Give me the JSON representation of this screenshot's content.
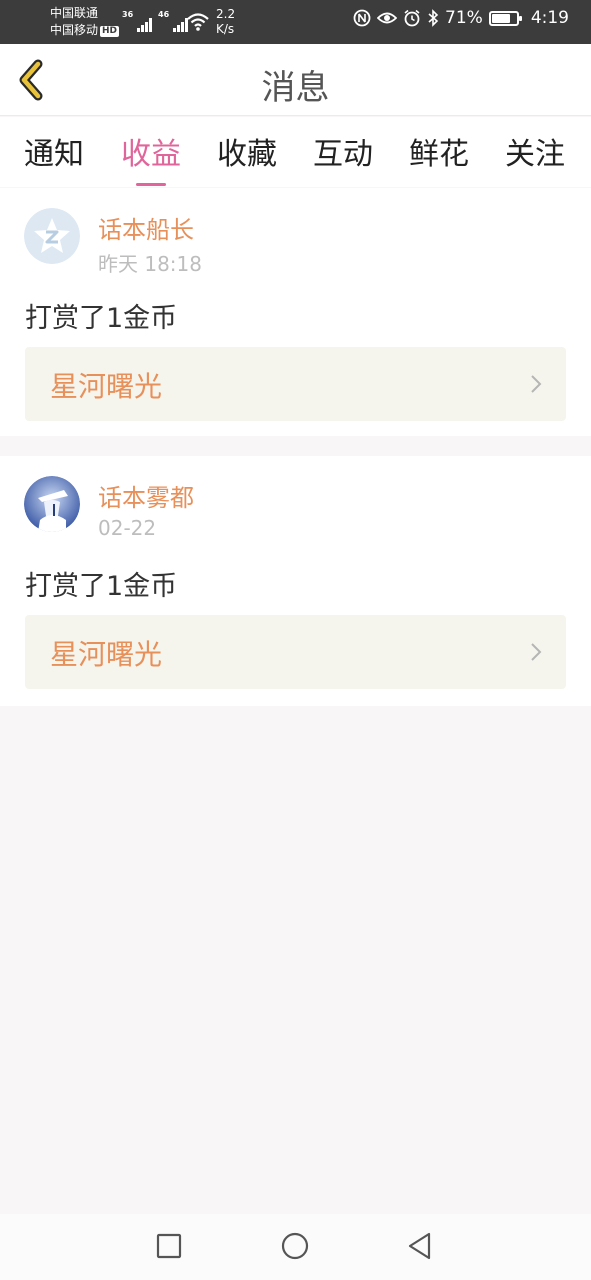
{
  "status_bar": {
    "carrier1": "中国联通",
    "carrier2": "中国移动",
    "hd_badge": "HD",
    "sim1_tag": "36",
    "sim2_tag": "46",
    "speed_value": "2.2",
    "speed_unit": "K/s",
    "battery_text": "71%",
    "battery_level": 0.71,
    "time": "4:19",
    "icons": [
      "nfc-icon",
      "eye-icon",
      "alarm-icon",
      "bluetooth-icon",
      "battery-icon"
    ]
  },
  "header": {
    "title": "消息",
    "back_icon": "chevron-left-icon"
  },
  "tabs": [
    {
      "label": "通知",
      "active": false
    },
    {
      "label": "收益",
      "active": true
    },
    {
      "label": "收藏",
      "active": false
    },
    {
      "label": "互动",
      "active": false
    },
    {
      "label": "鲜花",
      "active": false
    },
    {
      "label": "关注",
      "active": false
    }
  ],
  "messages": [
    {
      "user": "话本船长",
      "time": "昨天 18:18",
      "action": "打赏了1金币",
      "target": "星河曙光"
    },
    {
      "user": "话本雾都",
      "time": "02-22",
      "action": "打赏了1金币",
      "target": "星河曙光"
    }
  ],
  "colors": {
    "accent": "#e0659a",
    "name": "#e8905a",
    "back_arrow": "#e8c23a"
  },
  "navbar": {
    "icons": [
      "recent-apps-icon",
      "home-icon",
      "back-triangle-icon"
    ]
  }
}
